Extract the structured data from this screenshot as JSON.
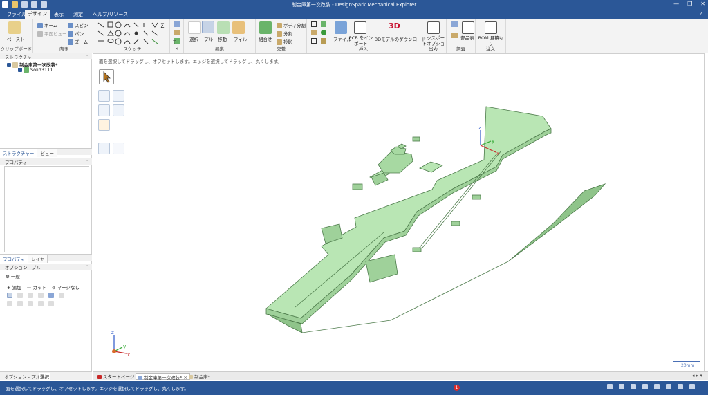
{
  "window": {
    "title": "制金庫第一次改装 - DesignSpark Mechanical Explorer",
    "minimize": "—",
    "restore": "❐",
    "close": "✕"
  },
  "menu": {
    "tabs": [
      "ファイル",
      "デザイン",
      "表示",
      "測定",
      "ヘルプ/リソース"
    ],
    "active": "デザイン",
    "help": "?"
  },
  "ribbon": {
    "clipboard": {
      "label": "クリップボード",
      "paste": "ペースト"
    },
    "orient": {
      "label": "向き",
      "home": "ホーム",
      "plane_view": "平面ビュー",
      "spin": "スピン",
      "pan": "パン",
      "zoom": "ズーム"
    },
    "sketch": {
      "label": "スケッチ"
    },
    "mode": {
      "label": "モード"
    },
    "edit": {
      "label": "編集",
      "select": "選択",
      "pull": "プル",
      "move": "移動",
      "fill": "フィル"
    },
    "intersect": {
      "label": "交差",
      "combine": "組合せ",
      "split_body": "ボディ分割",
      "split": "分割",
      "project": "投影"
    },
    "insert": {
      "label": "挿入",
      "file": "ファイル",
      "pcb": "PCB をインポート",
      "download3d": "3Dモデルのダウンロード",
      "logo3d": "3D"
    },
    "output": {
      "label": "出力",
      "export": "エクスポートオプション"
    },
    "investigate": {
      "label": "調査",
      "parts": "部品表"
    },
    "order": {
      "label": "注文",
      "bom": "BOM 見積もり"
    }
  },
  "structure": {
    "title": "ストラクチャー",
    "root": "制金庫第一次改装*",
    "child": "Solid3111",
    "tabs": [
      "ストラクチャー",
      "ビュー"
    ]
  },
  "properties": {
    "title": "プロパティ",
    "tabs": [
      "プロパティ",
      "レイヤ"
    ]
  },
  "options": {
    "title": "オプション - プル",
    "general": "一般",
    "add": "追加",
    "cut": "カット",
    "no_merge": "マージなし"
  },
  "bottom_tabs": [
    "オプション - プル",
    "選択"
  ],
  "canvas": {
    "hint": "面を選択してドラッグし、オフセットします。エッジを選択してドラッグし、丸くします。",
    "scale": "20mm"
  },
  "doc_tabs": [
    "スタートページ",
    "制金庫第一次改装*",
    "制金庫*"
  ],
  "status": {
    "message": "面を選択してドラッグし、オフセットします。エッジを選択してドラッグし、丸くします。",
    "badge": "1"
  },
  "colors": {
    "accent": "#2b5797",
    "model": "#b9e6b4",
    "model_edge": "#4c7a4a"
  }
}
